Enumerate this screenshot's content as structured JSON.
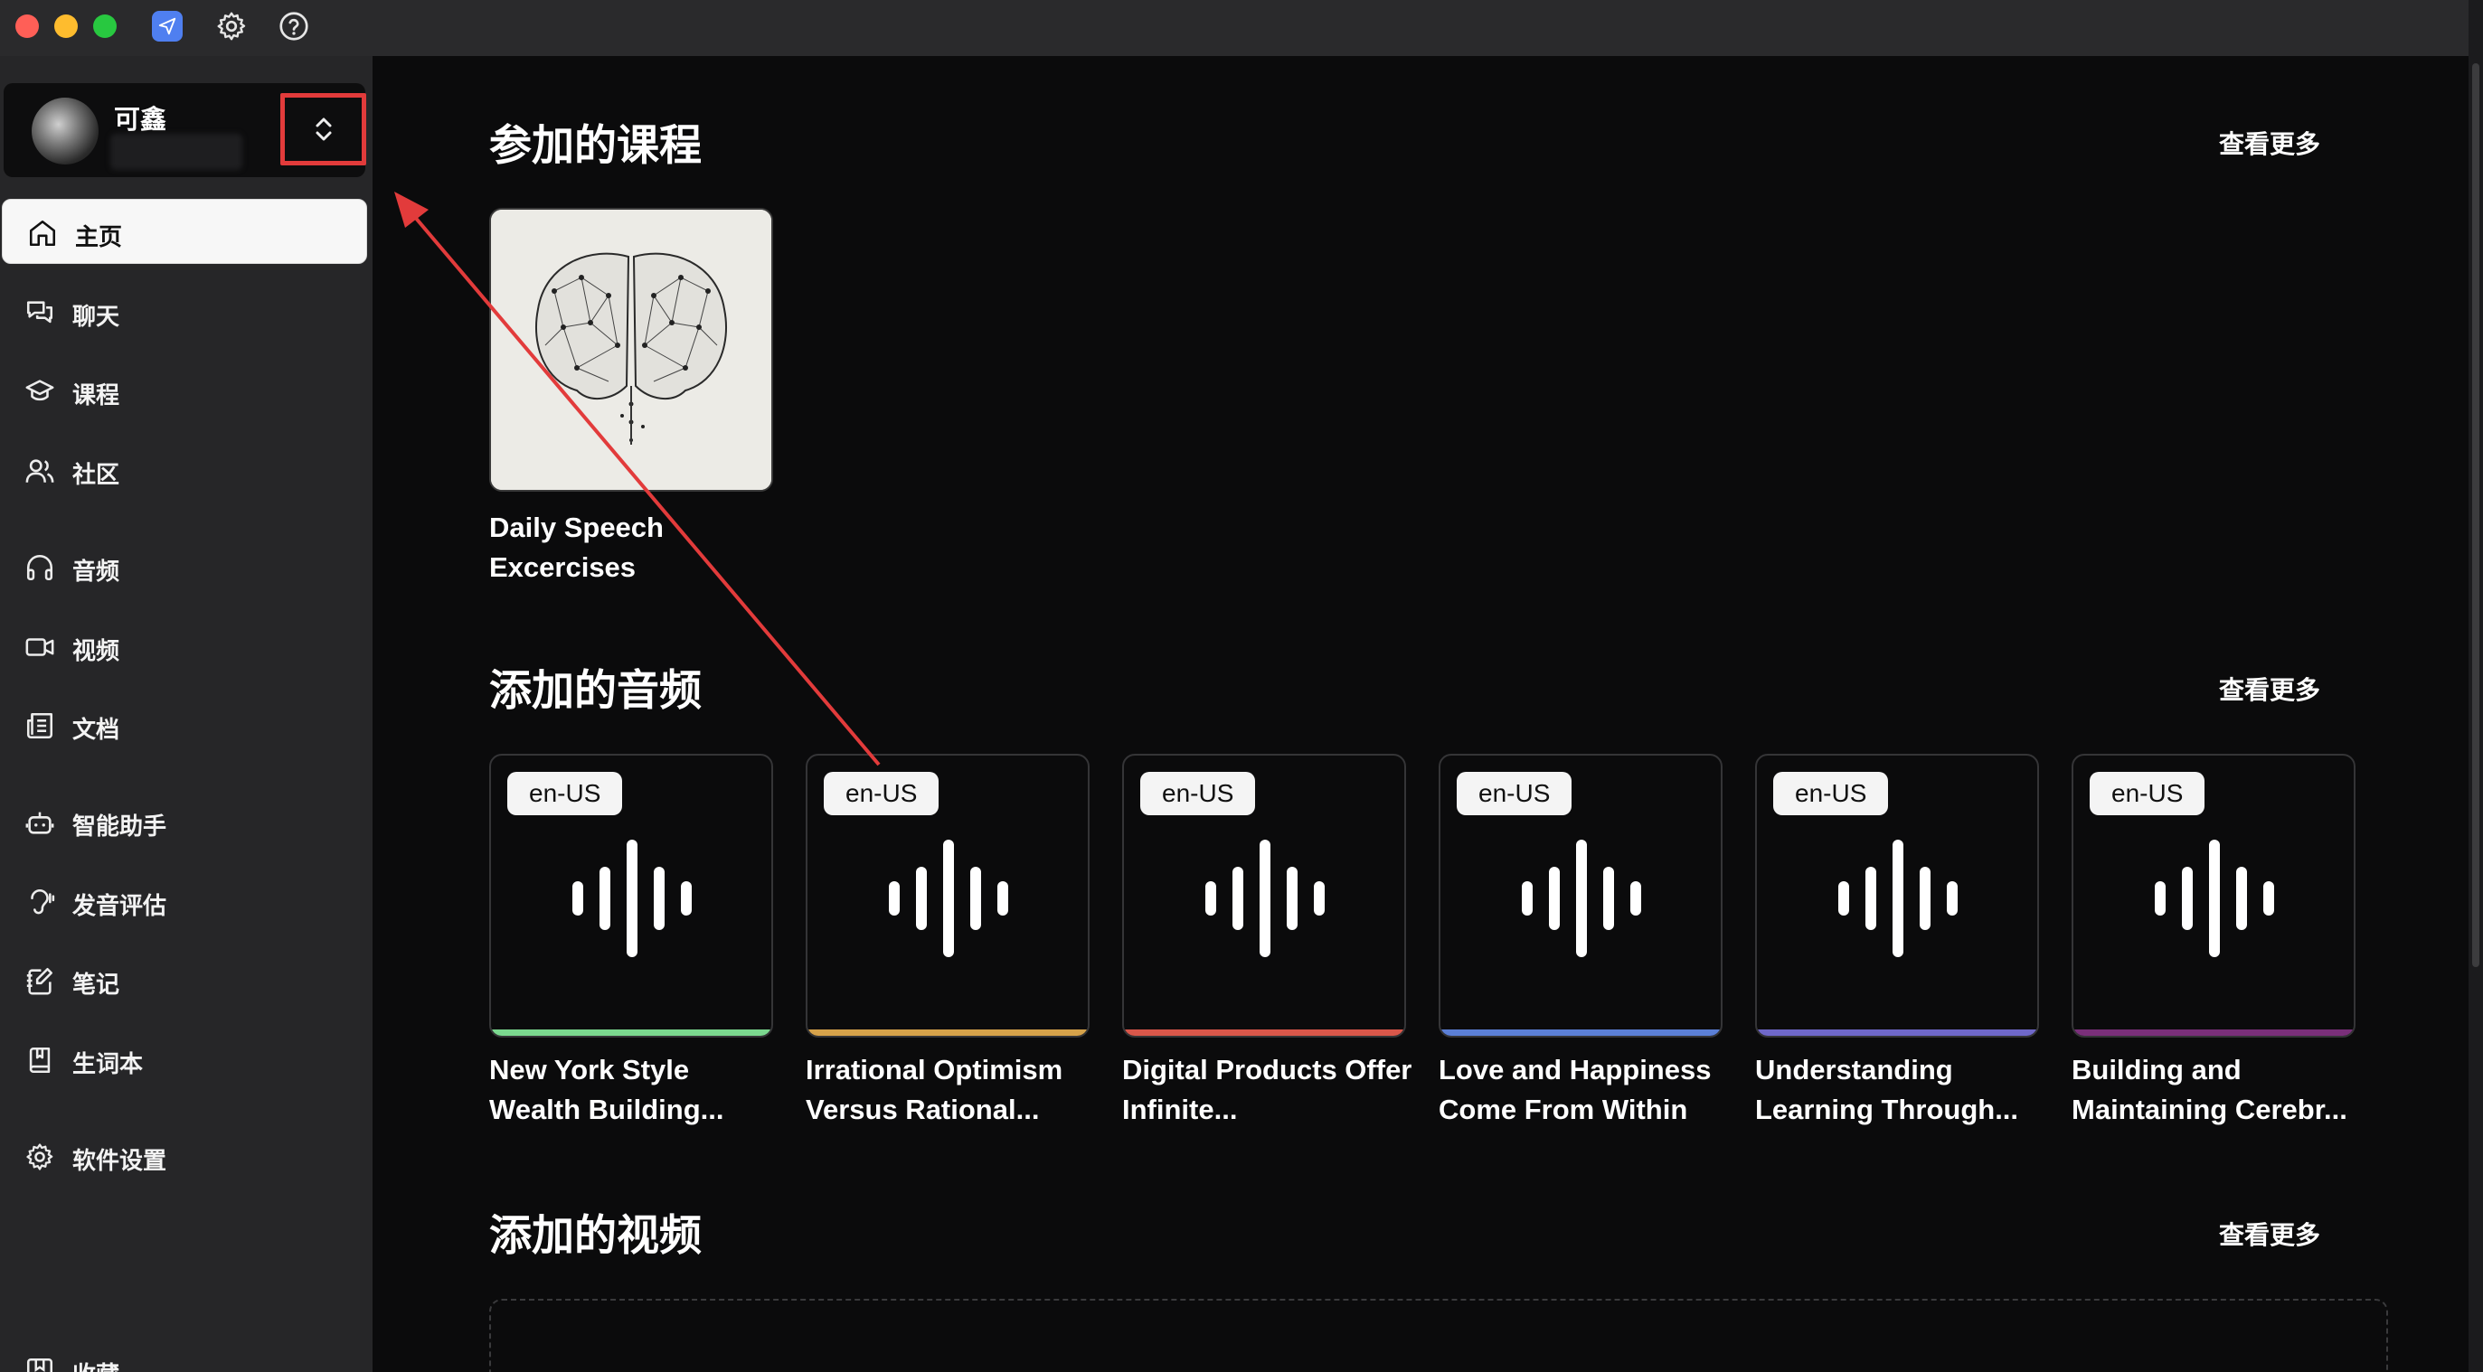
{
  "user": {
    "name": "可鑫"
  },
  "nav": {
    "home": "主页",
    "chat": "聊天",
    "courses": "课程",
    "community": "社区",
    "audio": "音频",
    "video": "视频",
    "documents": "文档",
    "assistant": "智能助手",
    "pronunciation": "发音评估",
    "notes": "笔记",
    "vocabulary": "生词本",
    "settings": "软件设置",
    "favorites": "收藏"
  },
  "sections": {
    "courses": {
      "title": "参加的课程",
      "more": "查看更多"
    },
    "audio": {
      "title": "添加的音频",
      "more": "查看更多"
    },
    "video": {
      "title": "添加的视频",
      "more": "查看更多"
    }
  },
  "course": {
    "title": "Daily Speech Excercises"
  },
  "audios": [
    {
      "lang": "en-US",
      "title": "New York Style Wealth Building...",
      "accent": "#7bd88f"
    },
    {
      "lang": "en-US",
      "title": "Irrational Optimism Versus Rational...",
      "accent": "#d6a24a"
    },
    {
      "lang": "en-US",
      "title": "Digital Products Offer Infinite...",
      "accent": "#d9574a"
    },
    {
      "lang": "en-US",
      "title": "Love and Happiness Come From Within",
      "accent": "#5b7fd6"
    },
    {
      "lang": "en-US",
      "title": "Understanding Learning Through...",
      "accent": "#6f68c9"
    },
    {
      "lang": "en-US",
      "title": "Building and Maintaining Cerebr...",
      "accent": "#7a2f7a"
    }
  ],
  "colors": {
    "annotation": "#e23b3b",
    "sidebar_bg": "#262628",
    "main_bg": "#0b0b0c"
  }
}
